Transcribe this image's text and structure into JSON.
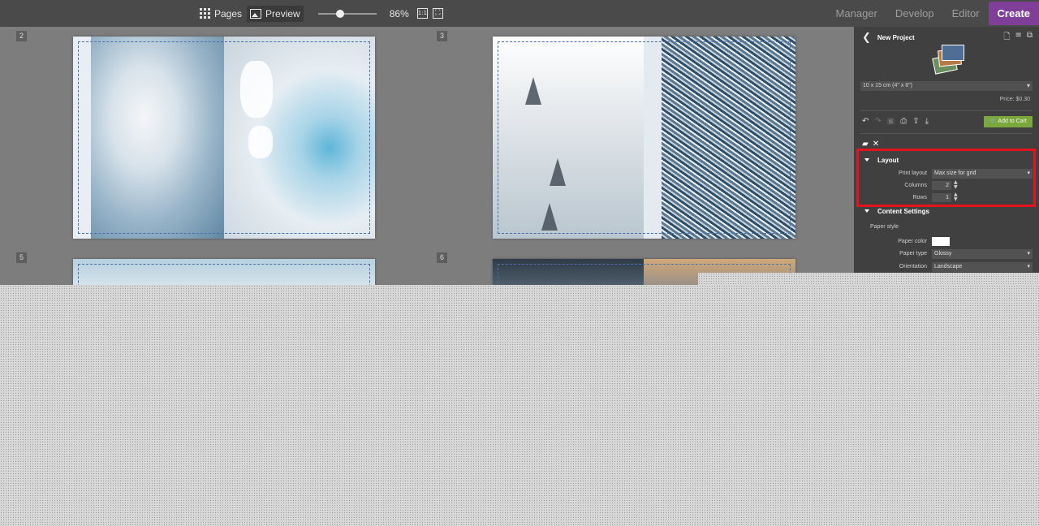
{
  "toolbar": {
    "pages_label": "Pages",
    "preview_label": "Preview",
    "zoom_value": "86%",
    "zoom_fraction": 0.35,
    "actual_size_label": "1:1"
  },
  "nav": {
    "manager": "Manager",
    "develop": "Develop",
    "editor": "Editor",
    "create": "Create"
  },
  "pages": [
    {
      "number": "2"
    },
    {
      "number": "3"
    },
    {
      "number": "5"
    },
    {
      "number": "6"
    }
  ],
  "panel": {
    "title": "New Project",
    "size_option": "10 x 15 cm (4\" x 6\")",
    "price": "Price: $0.30",
    "add_to_cart": "Add to Cart",
    "layout_section": "Layout",
    "print_layout_label": "Print layout",
    "print_layout_value": "Max size for grid",
    "columns_label": "Columns",
    "columns_value": "2",
    "rows_label": "Rows",
    "rows_value": "1",
    "content_settings_section": "Content Settings",
    "paper_style_label": "Paper style",
    "paper_color_label": "Paper color",
    "paper_color_value": "#ffffff",
    "paper_type_label": "Paper type",
    "paper_type_value": "Glossy",
    "orientation_label": "Orientation",
    "orientation_value": "Landscape"
  },
  "colors": {
    "accent_create": "#7f3f98",
    "cart_green": "#7aa83c",
    "highlight_red": "#e3141b"
  }
}
